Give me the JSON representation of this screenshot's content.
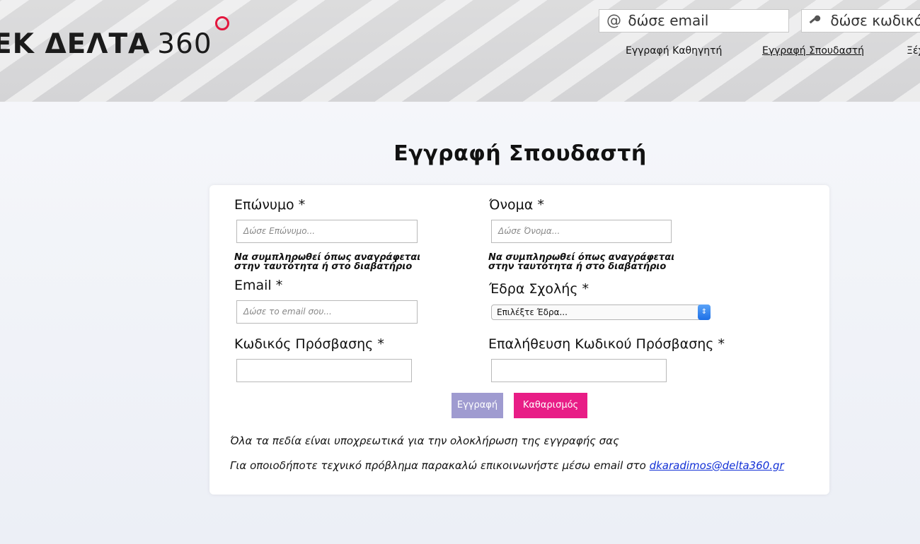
{
  "header": {
    "logo_bold": "ΕΚ ΔΕΛΤΑ",
    "logo_number": "360",
    "email_placeholder": "δώσε email",
    "password_placeholder": "δώσε κωδικό",
    "nav": {
      "teacher": "Εγγραφή Καθηγητή",
      "student": "Εγγραφή Σπουδαστή",
      "forgot": "Ξέχασα"
    }
  },
  "page_title": "Εγγραφή Σπουδαστή",
  "form": {
    "surname": {
      "label": "Επώνυμο *",
      "placeholder": "Δώσε Επώνυμο..."
    },
    "name": {
      "label": "Όνομα *",
      "placeholder": "Δώσε Όνομα..."
    },
    "hint_line1": "Να συμπληρωθεί όπως αναγράφεται",
    "hint_line2": "στην ταυτότητα ή στο διαβατήριο",
    "email": {
      "label": "Email *",
      "placeholder": "Δώσε το email σου..."
    },
    "school": {
      "label": "Έδρα Σχολής *",
      "selected": "Επιλέξτε Έδρα..."
    },
    "password": {
      "label": "Κωδικός Πρόσβασης *"
    },
    "password_confirm": {
      "label": "Επαλήθευση Κωδικού Πρόσβασης *"
    },
    "submit_label": "Εγγραφή",
    "reset_label": "Καθαρισμός",
    "note_required": "Όλα τα πεδία είναι υποχρεωτικά για την ολοκλήρωση της εγγραφής σας",
    "note_support": "Για οποιοδήποτε τεχνικό πρόβλημα παρακαλώ επικοινωνήστε μέσω email στο",
    "support_email": "dkaradimos@delta360.gr"
  },
  "colors": {
    "accent": "#e3173e",
    "submit": "#9f9bd0",
    "reset": "#e81d86",
    "link": "#1230d6"
  }
}
